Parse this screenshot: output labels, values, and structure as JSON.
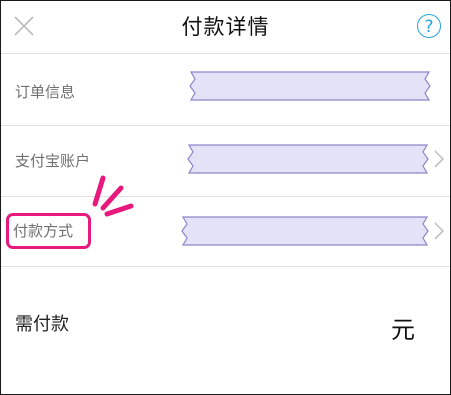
{
  "header": {
    "title": "付款详情",
    "help_glyph": "?"
  },
  "rows": [
    {
      "label": "订单信息",
      "value_masked": true,
      "has_chevron": false
    },
    {
      "label": "支付宝账户",
      "value_masked": true,
      "has_chevron": true
    },
    {
      "label": "付款方式",
      "value_masked": true,
      "has_chevron": true,
      "highlighted": true
    }
  ],
  "amount": {
    "label": "需付款",
    "currency": "元"
  },
  "colors": {
    "help_blue": "#27a3d9",
    "highlight_pink": "#e8197d",
    "mask_fill": "#e4e2f7",
    "mask_stroke": "#8c86c9"
  },
  "icons": {
    "close": "close-icon",
    "help": "question-icon",
    "chevron": "chevron-right-icon"
  }
}
